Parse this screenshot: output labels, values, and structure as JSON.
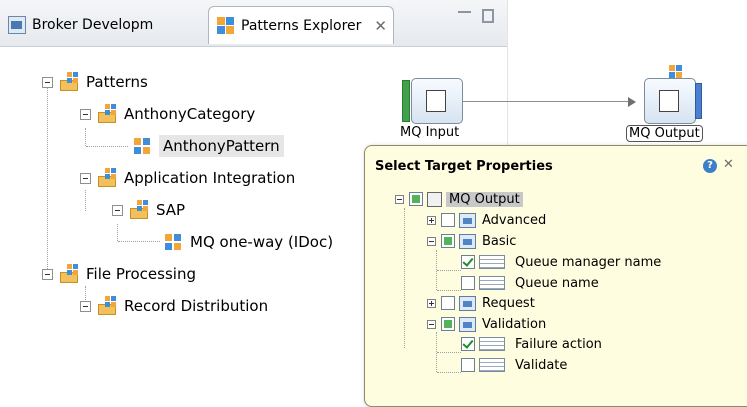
{
  "explorer": {
    "tabs": [
      {
        "label": "Broker Developm"
      },
      {
        "label": "Patterns Explorer"
      }
    ],
    "tab_close_glyph": "✕",
    "tree": [
      {
        "label": "Patterns"
      },
      {
        "label": "AnthonyCategory"
      },
      {
        "label": "AnthonyPattern",
        "selected": true
      },
      {
        "label": "Application Integration"
      },
      {
        "label": "SAP"
      },
      {
        "label": "MQ one-way (IDoc)"
      },
      {
        "label": "File Processing"
      },
      {
        "label": "Record Distribution"
      }
    ]
  },
  "flow": {
    "input_label": "MQ Input",
    "output_label": "MQ Output"
  },
  "popup": {
    "title": "Select Target Properties",
    "help_glyph": "?",
    "close_glyph": "✕",
    "items": [
      {
        "label": "MQ Output",
        "state": "partial",
        "selected": true
      },
      {
        "label": "Advanced",
        "state": "unchecked"
      },
      {
        "label": "Basic",
        "state": "partial"
      },
      {
        "label": "Queue manager name",
        "state": "checked"
      },
      {
        "label": "Queue name",
        "state": "unchecked"
      },
      {
        "label": "Request",
        "state": "unchecked"
      },
      {
        "label": "Validation",
        "state": "partial"
      },
      {
        "label": "Failure action",
        "state": "checked"
      },
      {
        "label": "Validate",
        "state": "unchecked"
      }
    ]
  },
  "colors": {
    "popup_bg": "#fffde0",
    "check_green": "#52b35b",
    "selection_gray": "#c8c8c8"
  }
}
